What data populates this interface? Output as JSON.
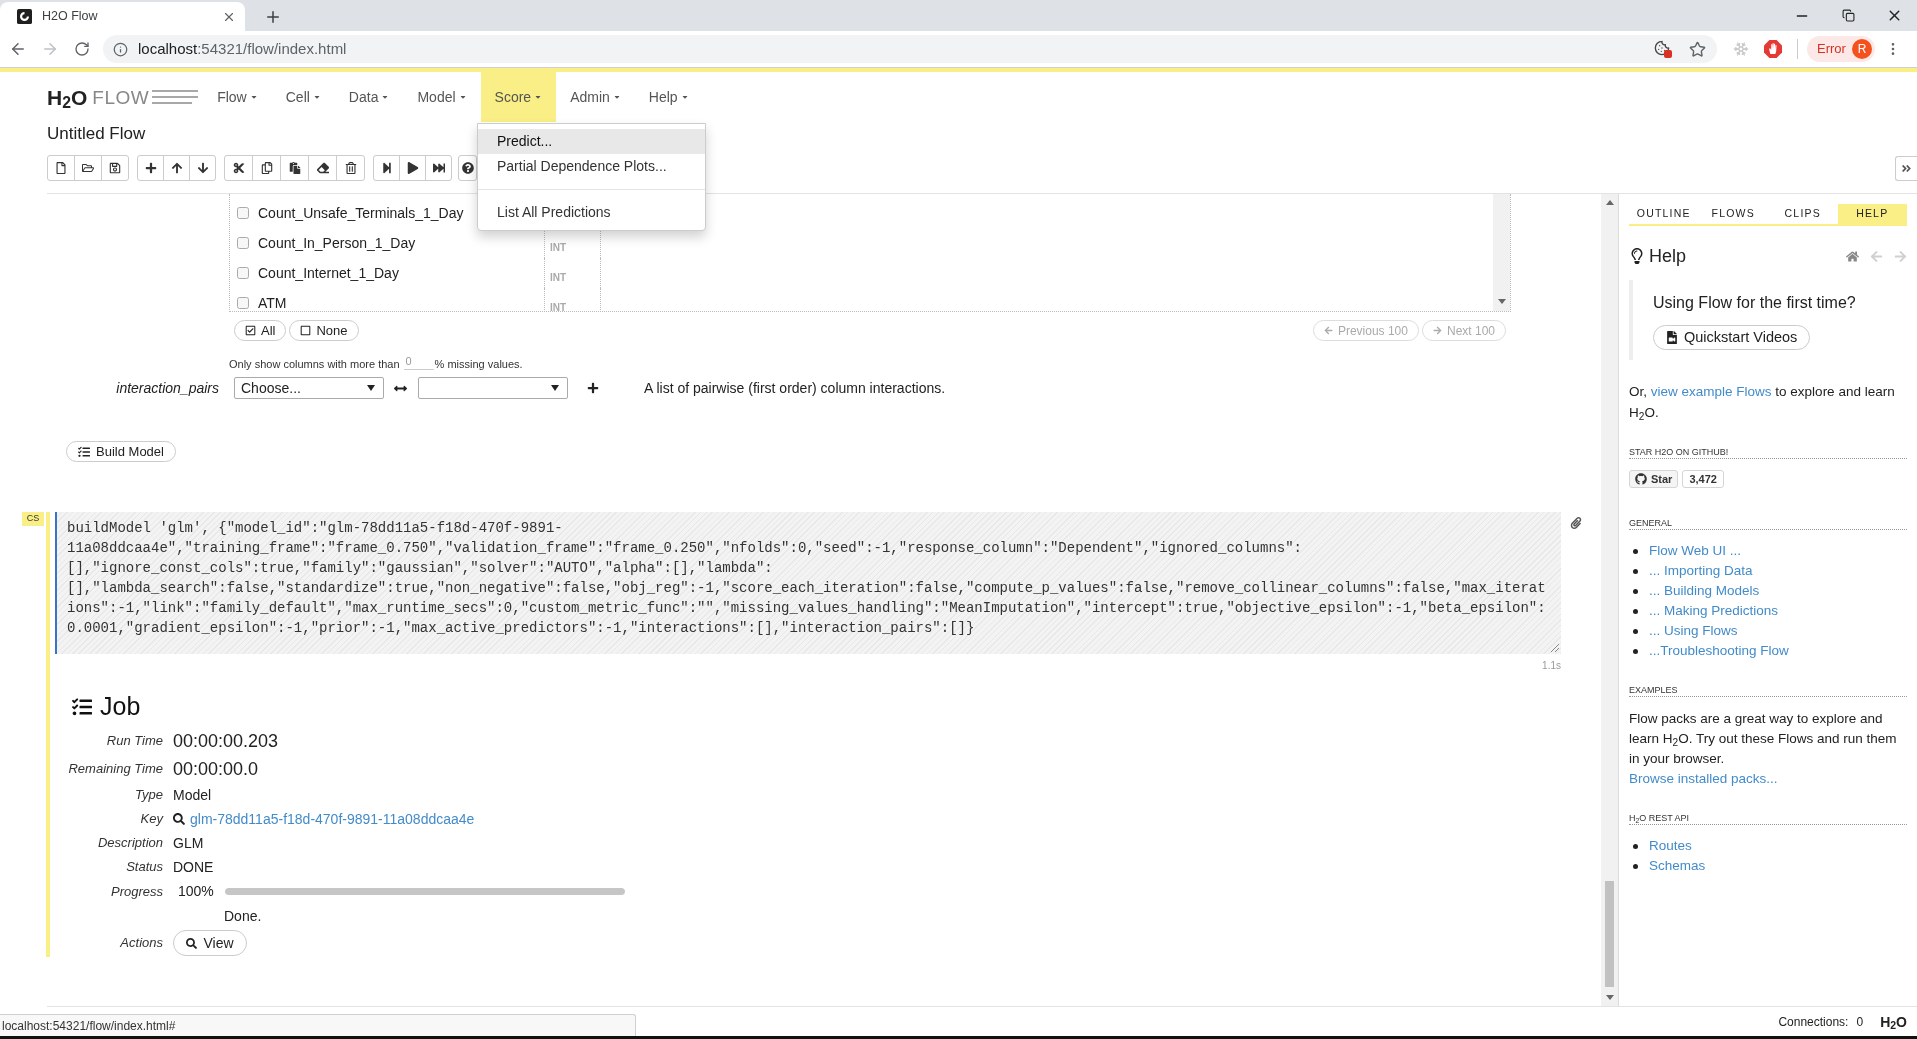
{
  "browser": {
    "tab_title": "H2O Flow",
    "back": {
      "disabled": false
    },
    "forward": {
      "disabled": true
    },
    "url_host": "localhost",
    "url_path": ":54321/flow/index.html",
    "profile_status": "Error",
    "profile_initial": "R",
    "status_url": "localhost:54321/flow/index.html#"
  },
  "header": {
    "logo_mark": "H$_{2}$O",
    "logo_name": "FLOW",
    "menu": [
      {
        "label": "Flow",
        "selected": false
      },
      {
        "label": "Cell",
        "selected": false
      },
      {
        "label": "Data",
        "selected": false
      },
      {
        "label": "Model",
        "selected": false
      },
      {
        "label": "Score",
        "selected": true
      },
      {
        "label": "Admin",
        "selected": false
      },
      {
        "label": "Help",
        "selected": false
      }
    ]
  },
  "score_menu": {
    "groups": [
      [
        {
          "label": "Predict...",
          "highlighted": true
        },
        {
          "label": "Partial Dependence Plots...",
          "highlighted": false
        }
      ],
      [
        {
          "label": "List All Predictions",
          "highlighted": false
        }
      ]
    ]
  },
  "flow_title": "Untitled Flow",
  "columns": {
    "rows": [
      {
        "name": "Count_Unsafe_Terminals_1_Day",
        "checked": false
      },
      {
        "name": "Count_In_Person_1_Day",
        "type": "INT",
        "checked": false
      },
      {
        "name": "Count_Internet_1_Day",
        "type": "INT",
        "checked": false
      },
      {
        "name": "ATM",
        "type": "INT",
        "checked": false
      }
    ],
    "select_all": "All",
    "select_none": "None",
    "previous": {
      "label": "Previous 100",
      "disabled": true
    },
    "next": {
      "label": "Next 100",
      "disabled": true
    },
    "filter_before": "Only show columns with more than",
    "filter_value": "0",
    "filter_after": "% missing values."
  },
  "interaction_pairs": {
    "label": "interaction_pairs",
    "first_value": "Choose...",
    "description": "A list of pairwise (first order) column interactions."
  },
  "build_model": "Build Model",
  "code_cell": {
    "badge": "CS",
    "selected": true,
    "lines": [
      "buildModel 'glm', {\"model_id\":\"glm-78dd11a5-f18d-470f-9891-",
      "11a08ddcaa4e\",\"training_frame\":\"frame_0.750\",\"validation_frame\":\"frame_0.250\",\"nfolds\":0,\"seed\":-1,\"response_column\":\"Dependent\",\"ignored_columns\":",
      "[],\"ignore_const_cols\":true,\"family\":\"gaussian\",\"solver\":\"AUTO\",\"alpha\":[],\"lambda\":",
      "[],\"lambda_search\":false,\"standardize\":true,\"non_negative\":false,\"obj_reg\":-1,\"score_each_iteration\":false,\"compute_p_values\":false,\"remove_collinear_columns\":false,\"max_iterat",
      "ions\":-1,\"link\":\"family_default\",\"max_runtime_secs\":0,\"custom_metric_func\":\"\",\"missing_values_handling\":\"MeanImputation\",\"intercept\":true,\"objective_epsilon\":-1,\"beta_epsilon\":",
      "0.0001,\"gradient_epsilon\":-1,\"prior\":-1,\"max_active_predictors\":-1,\"interactions\":[],\"interaction_pairs\":[]}"
    ],
    "duration": "1.1s"
  },
  "job": {
    "title": "Job",
    "fields": [
      {
        "kind": "large",
        "label": "Run Time",
        "value": "00:00:00.203"
      },
      {
        "kind": "large",
        "label": "Remaining Time",
        "value": "00:00:00.0"
      },
      {
        "kind": "text",
        "label": "Type",
        "value": "Model"
      },
      {
        "kind": "link",
        "label": "Key",
        "value": "glm-78dd11a5-f18d-470f-9891-11a08ddcaa4e"
      },
      {
        "kind": "text",
        "label": "Description",
        "value": "GLM"
      },
      {
        "kind": "text",
        "label": "Status",
        "value": "DONE"
      },
      {
        "kind": "progress",
        "label": "Progress",
        "value": "100%",
        "level": 1
      },
      {
        "kind": "message",
        "value": "Done."
      },
      {
        "kind": "button",
        "label": "Actions",
        "value": "View"
      }
    ]
  },
  "side_panel": {
    "tabs": [
      {
        "label": "OUTLINE",
        "selected": false
      },
      {
        "label": "FLOWS",
        "selected": false
      },
      {
        "label": "CLIPS",
        "selected": false
      },
      {
        "label": "HELP",
        "selected": true
      }
    ],
    "title": "Help",
    "back": {
      "disabled": true
    },
    "forward": {
      "disabled": true
    },
    "intro_question": "Using Flow for the first time?",
    "intro_button": "Quickstart Videos",
    "intro_before": "Or,",
    "intro_link": "view example Flows",
    "intro_after": "to explore and learn H$_{2}$O.",
    "sections": [
      {
        "kind": "github",
        "heading": "STAR H2O ON GITHUB!",
        "star": "Star",
        "count": "3,472"
      },
      {
        "kind": "links",
        "heading": "GENERAL",
        "links": [
          "Flow Web UI ...",
          "... Importing Data",
          "... Building Models",
          "... Making Predictions",
          "... Using Flows",
          "...Troubleshooting Flow"
        ]
      },
      {
        "kind": "text",
        "heading": "EXAMPLES",
        "text": "Flow packs are a great way to explore and learn H$_{2}$O. Try out these Flows and run them in your browser.",
        "link": "Browse installed packs..."
      },
      {
        "kind": "links",
        "heading": "H$_{2}$O REST API",
        "links": [
          "Routes",
          "Schemas"
        ]
      }
    ]
  },
  "footer": {
    "connections_label": "Connections:",
    "connections_value": "0",
    "logo": "H$_{2}$O"
  }
}
